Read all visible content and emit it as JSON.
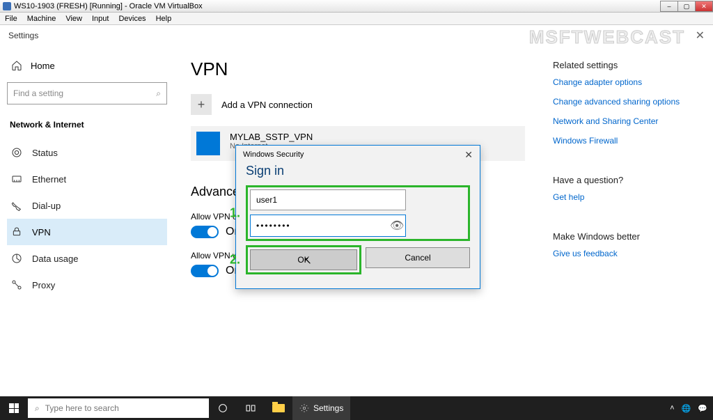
{
  "vb": {
    "title": "WS10-1903 (FRESH) [Running] - Oracle VM VirtualBox",
    "menu": [
      "File",
      "Machine",
      "View",
      "Input",
      "Devices",
      "Help"
    ]
  },
  "settings": {
    "title": "Settings",
    "watermark": "MSFTWEBCAST",
    "home": "Home",
    "search_placeholder": "Find a setting",
    "category": "Network & Internet",
    "nav": {
      "status": "Status",
      "ethernet": "Ethernet",
      "dialup": "Dial-up",
      "vpn": "VPN",
      "data": "Data usage",
      "proxy": "Proxy"
    }
  },
  "main": {
    "heading": "VPN",
    "add": "Add a VPN connection",
    "vpn_name": "MYLAB_SSTP_VPN",
    "vpn_status": "No Internet",
    "advanced": "Advanced Options",
    "opt1": "Allow VPN over metered networks",
    "opt2": "Allow VPN while roaming",
    "on": "On"
  },
  "right": {
    "related": "Related settings",
    "l1": "Change adapter options",
    "l2": "Change advanced sharing options",
    "l3": "Network and Sharing Center",
    "l4": "Windows Firewall",
    "q": "Have a question?",
    "help": "Get help",
    "better": "Make Windows better",
    "fb": "Give us feedback"
  },
  "dialog": {
    "title": "Windows Security",
    "heading": "Sign in",
    "username": "user1",
    "password_mask": "••••••••",
    "ok": "OK",
    "cancel": "Cancel",
    "badge1": "1.",
    "badge2": "2."
  },
  "taskbar": {
    "search": "Type here to search",
    "settings": "Settings"
  }
}
